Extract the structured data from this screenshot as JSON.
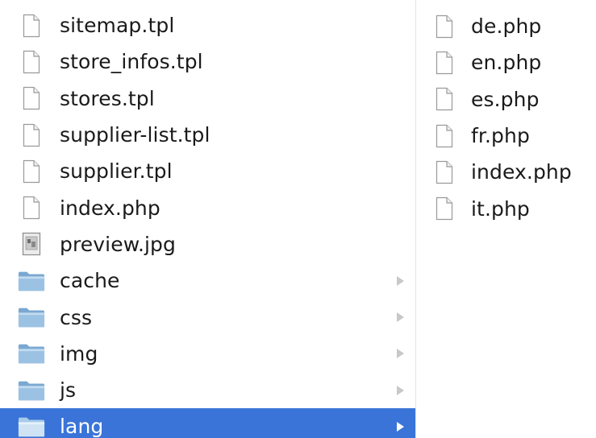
{
  "left_column": {
    "items": [
      {
        "name": "sitemap.tpl",
        "kind": "document",
        "icon": "document-icon"
      },
      {
        "name": "store_infos.tpl",
        "kind": "document",
        "icon": "document-icon"
      },
      {
        "name": "stores.tpl",
        "kind": "document",
        "icon": "document-icon"
      },
      {
        "name": "supplier-list.tpl",
        "kind": "document",
        "icon": "document-icon"
      },
      {
        "name": "supplier.tpl",
        "kind": "document",
        "icon": "document-icon"
      },
      {
        "name": "index.php",
        "kind": "document",
        "icon": "document-icon"
      },
      {
        "name": "preview.jpg",
        "kind": "image",
        "icon": "image-file-icon"
      },
      {
        "name": "cache",
        "kind": "folder",
        "icon": "folder-icon"
      },
      {
        "name": "css",
        "kind": "folder",
        "icon": "folder-icon"
      },
      {
        "name": "img",
        "kind": "folder",
        "icon": "folder-icon"
      },
      {
        "name": "js",
        "kind": "folder",
        "icon": "folder-icon"
      },
      {
        "name": "lang",
        "kind": "folder",
        "icon": "folder-icon",
        "selected": true
      }
    ]
  },
  "right_column": {
    "items": [
      {
        "name": "de.php",
        "kind": "document",
        "icon": "document-icon"
      },
      {
        "name": "en.php",
        "kind": "document",
        "icon": "document-icon"
      },
      {
        "name": "es.php",
        "kind": "document",
        "icon": "document-icon"
      },
      {
        "name": "fr.php",
        "kind": "document",
        "icon": "document-icon"
      },
      {
        "name": "index.php",
        "kind": "document",
        "icon": "document-icon"
      },
      {
        "name": "it.php",
        "kind": "document",
        "icon": "document-icon"
      }
    ]
  },
  "colors": {
    "selection": "#3a74d8",
    "folder_body": "#8fb7d9",
    "folder_light": "#bcd6ec",
    "disclosure_arrow": "#c8c8c8"
  }
}
